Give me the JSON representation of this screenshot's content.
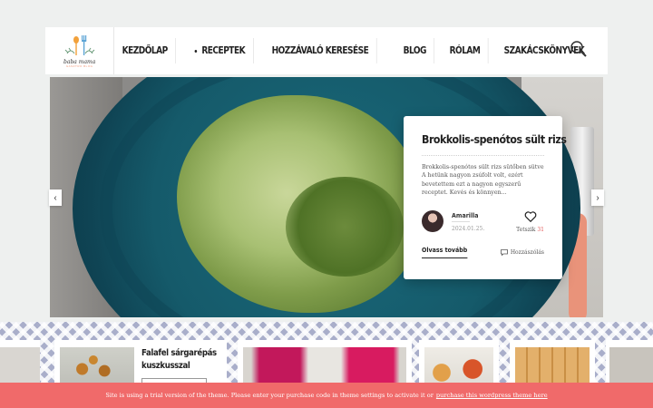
{
  "brand": {
    "name": "baba mama",
    "tagline": "GASZTRO BLOG",
    "colors": {
      "accent": "#f06a6a",
      "pattern": "#a9aeca"
    }
  },
  "nav": {
    "items": [
      {
        "label": "KEZDŐLAP"
      },
      {
        "label": "RECEPTEK",
        "has_dropdown": true
      },
      {
        "label": "HOZZÁVALÓ KERESÉSE"
      },
      {
        "label": "BLOG"
      },
      {
        "label": "RÓLAM"
      },
      {
        "label": "SZAKÁCSKÖNYVEK"
      }
    ],
    "search_icon": "search-icon"
  },
  "slider": {
    "prev_icon": "chevron-left-icon",
    "next_icon": "chevron-right-icon",
    "card": {
      "title": "Brokkolis-spenótos sült rizs",
      "excerpt": "Brokkolis-spenótos sült rizs sütőben sütve A hetünk nagyon zsúfolt volt, ezért bevetettem ezt a nagyon egyszerű receptet. Kevés és könnyen...",
      "author": "Amarilla",
      "date": "2024.01.25.",
      "like_label": "Tetszik",
      "like_count": "31",
      "read_more": "Olvass tovább",
      "comment_label": "Hozzászólás"
    }
  },
  "featured": [
    {
      "title_line1": "Falafel sárgarépás",
      "title_line2": "kuszkusszal"
    }
  ],
  "notice": {
    "text": "Site is using a trial version of the theme. Please enter your purchase code in theme settings to activate it or",
    "link": "purchase this wordpress theme here"
  }
}
